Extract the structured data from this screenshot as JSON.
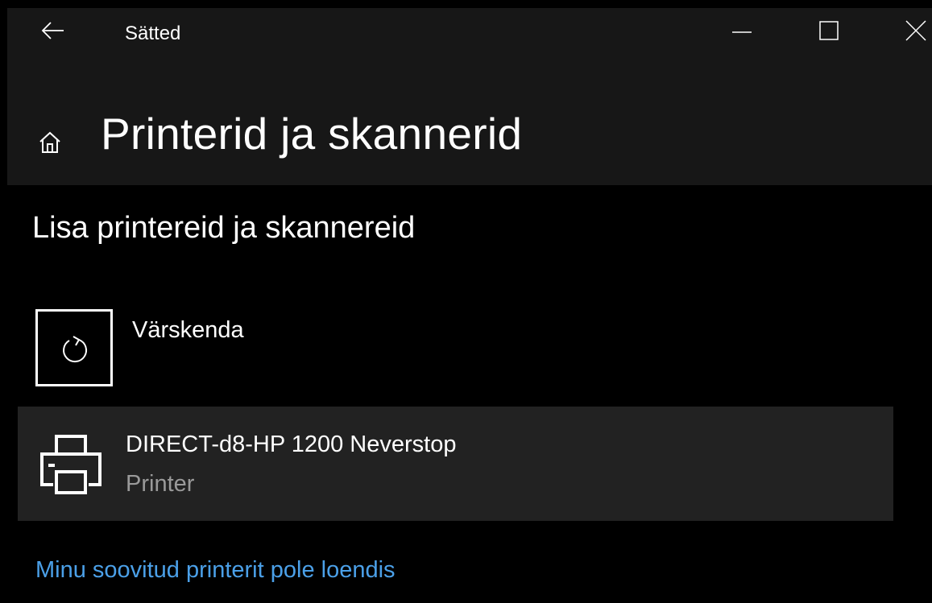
{
  "window": {
    "title": "Sätted",
    "controls": {
      "back_icon": "arrow-left-icon",
      "minimize_icon": "minimize-icon",
      "maximize_icon": "maximize-icon",
      "close_icon": "close-icon"
    }
  },
  "header": {
    "home_icon": "home-icon",
    "title": "Printerid ja skannerid"
  },
  "section": {
    "heading": "Lisa printereid ja skannereid",
    "refresh": {
      "icon": "refresh-icon",
      "label": "Värskenda"
    },
    "devices": [
      {
        "icon": "printer-icon",
        "name": "DIRECT-d8-HP 1200 Neverstop",
        "type": "Printer"
      }
    ],
    "help_link": "Minu soovitud printerit pole loendis"
  },
  "colors": {
    "background": "#000000",
    "titlebar": "#171717",
    "device_item_bg": "#222222",
    "secondary_text": "#9a9a9a",
    "link": "#4ba0e8"
  }
}
